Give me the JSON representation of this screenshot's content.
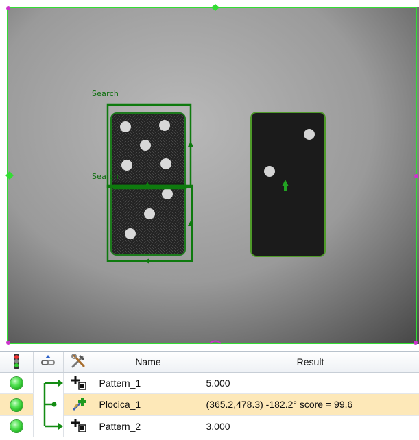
{
  "viewer": {
    "regions": [
      {
        "label": "Search"
      },
      {
        "label": "Search"
      }
    ]
  },
  "table": {
    "header": {
      "status_icon": "status-light-icon",
      "link_icon": "link-icon",
      "tools_icon": "tools-icon",
      "name": "Name",
      "result": "Result"
    },
    "rows": [
      {
        "status": "ok",
        "tool_icon": "pattern-tool-icon",
        "name": "Pattern_1",
        "result": "5.000",
        "selected": false
      },
      {
        "status": "ok",
        "tool_icon": "fixture-tool-icon",
        "name": "Plocica_1",
        "result": "(365.2,478.3) -182.2° score = 99.6",
        "selected": true
      },
      {
        "status": "ok",
        "tool_icon": "pattern-tool-icon",
        "name": "Pattern_2",
        "result": "3.000",
        "selected": false
      }
    ]
  },
  "colors": {
    "overlay_green": "#0c6e0c",
    "roi_green": "#33dd33",
    "handle_magenta": "#cc33cc",
    "selected_row": "#fde8b8",
    "status_green": "#3fd93f"
  }
}
